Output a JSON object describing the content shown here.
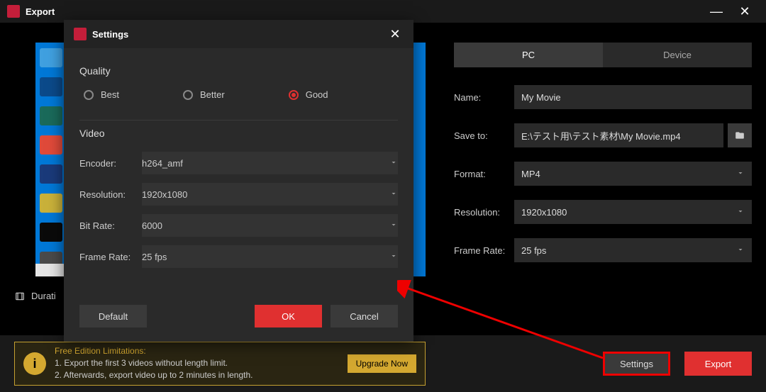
{
  "window": {
    "title": "Export"
  },
  "tabs": {
    "pc": "PC",
    "device": "Device"
  },
  "form": {
    "name_label": "Name:",
    "name_value": "My Movie",
    "save_label": "Save to:",
    "save_value": "E:\\テスト用\\テスト素材\\My Movie.mp4",
    "format_label": "Format:",
    "format_value": "MP4",
    "resolution_label": "Resolution:",
    "resolution_value": "1920x1080",
    "framerate_label": "Frame Rate:",
    "framerate_value": "25 fps"
  },
  "duration_label": "Durati",
  "limitations": {
    "header": "Free Edition Limitations:",
    "line1": "1. Export the first 3 videos without length limit.",
    "line2": "2. Afterwards, export video up to 2 minutes in length.",
    "upgrade": "Upgrade Now"
  },
  "footer": {
    "settings": "Settings",
    "export": "Export"
  },
  "modal": {
    "title": "Settings",
    "quality_label": "Quality",
    "q_best": "Best",
    "q_better": "Better",
    "q_good": "Good",
    "video_label": "Video",
    "encoder_label": "Encoder:",
    "encoder_value": "h264_amf",
    "resolution_label": "Resolution:",
    "resolution_value": "1920x1080",
    "bitrate_label": "Bit Rate:",
    "bitrate_value": "6000",
    "framerate_label": "Frame Rate:",
    "framerate_value": "25 fps",
    "default": "Default",
    "ok": "OK",
    "cancel": "Cancel"
  }
}
